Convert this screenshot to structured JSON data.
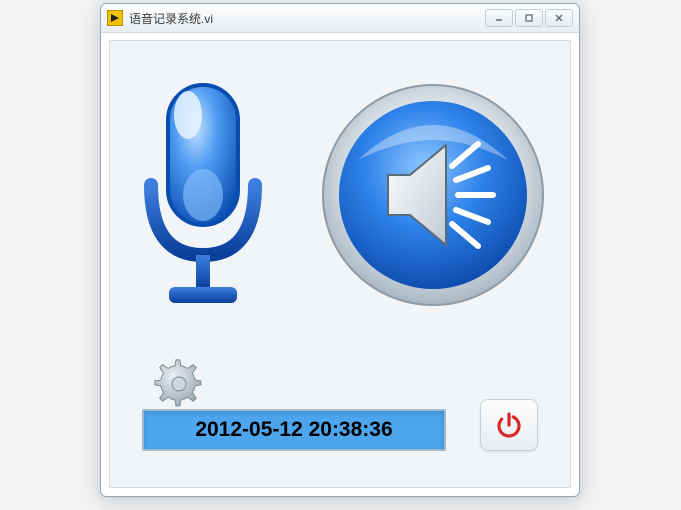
{
  "window": {
    "title": "语音记录系统.vi"
  },
  "icons": {
    "record": "microphone-icon",
    "play": "speaker-icon",
    "settings": "gear-icon",
    "power": "power-icon"
  },
  "timestamp": "2012-05-12 20:38:36",
  "colors": {
    "accent_blue": "#2b7de0",
    "timestamp_bg": "#4da5ee",
    "power_red": "#d42a2a"
  }
}
